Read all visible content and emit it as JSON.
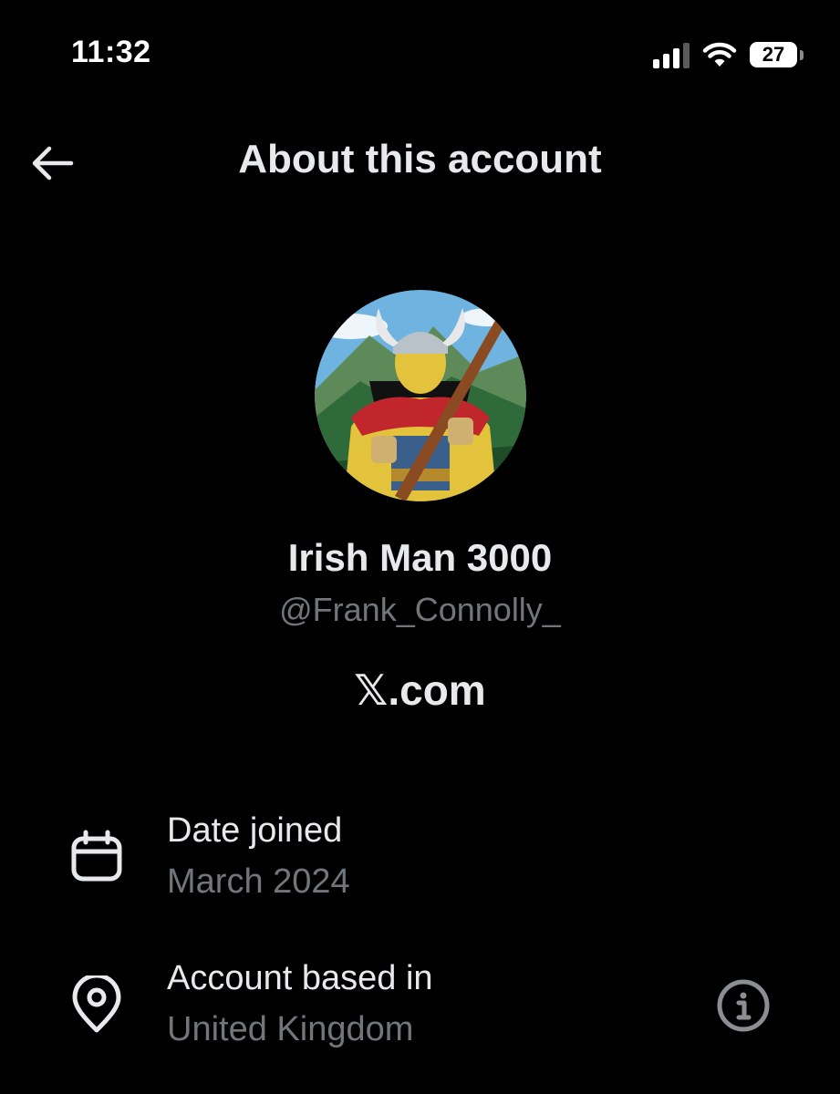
{
  "status_bar": {
    "time": "11:32",
    "battery_level": "27",
    "signal_bars_active": 3,
    "signal_bars_total": 4
  },
  "header": {
    "title": "About this account",
    "back_icon": "arrow-left-icon"
  },
  "profile": {
    "display_name": "Irish Man 3000",
    "handle": "@Frank_Connolly_",
    "platform": "𝕏.com",
    "avatar_description_icon": "viking-warrior-avatar"
  },
  "details": [
    {
      "icon": "calendar-icon",
      "label": "Date joined",
      "value": "March 2024"
    },
    {
      "icon": "location-pin-icon",
      "label": "Account based in",
      "value": "United Kingdom",
      "action_icon": "info-icon"
    }
  ],
  "colors": {
    "background": "#000000",
    "primary_text": "#e7e9ea",
    "secondary_text": "#71767b"
  }
}
